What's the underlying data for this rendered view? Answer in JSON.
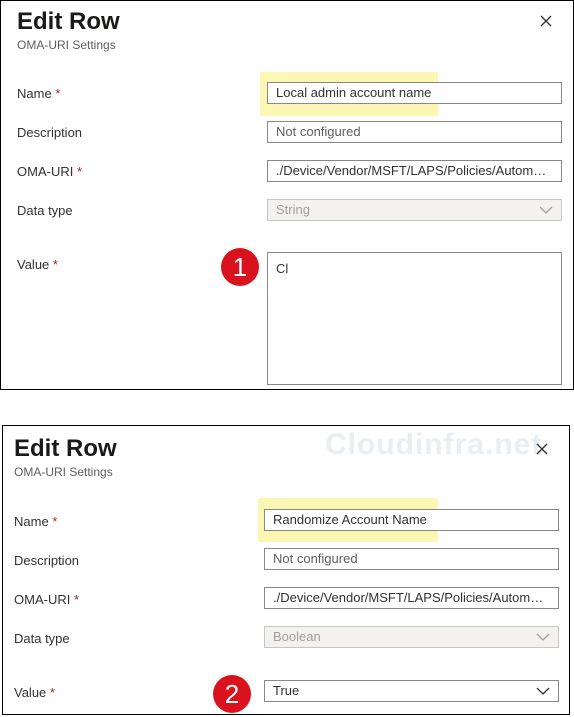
{
  "panel1": {
    "title": "Edit Row",
    "subtitle": "OMA-URI Settings",
    "fields": {
      "name_label": "Name",
      "name_value": "Local admin account name",
      "description_label": "Description",
      "description_placeholder": "Not configured",
      "omauri_label": "OMA-URI",
      "omauri_value": "./Device/Vendor/MSFT/LAPS/Policies/Automat...",
      "datatype_label": "Data type",
      "datatype_value": "String",
      "value_label": "Value",
      "value_value": "Cl"
    },
    "badge": "1"
  },
  "panel2": {
    "title": "Edit Row",
    "subtitle": "OMA-URI Settings",
    "fields": {
      "name_label": "Name",
      "name_value": "Randomize Account Name",
      "description_label": "Description",
      "description_placeholder": "Not configured",
      "omauri_label": "OMA-URI",
      "omauri_value": "./Device/Vendor/MSFT/LAPS/Policies/Automat...",
      "datatype_label": "Data type",
      "datatype_value": "Boolean",
      "value_label": "Value",
      "value_value": "True"
    },
    "badge": "2",
    "watermark": "Cloudinfra.net"
  },
  "required_marker": "*",
  "colors": {
    "highlight": "#fcf7b3",
    "badge": "#d9121e",
    "required": "#a4262c"
  }
}
